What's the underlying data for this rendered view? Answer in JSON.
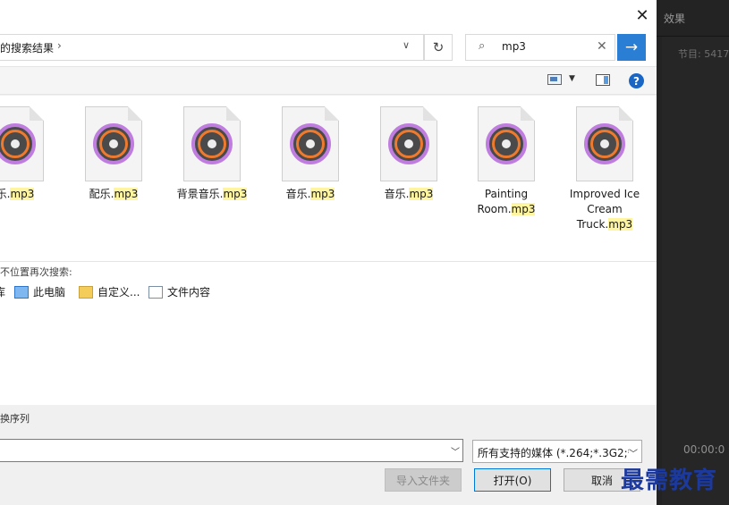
{
  "background_app": {
    "effects_tab": "效果",
    "program_label": "节目: 5417",
    "timecode": "00:00:0"
  },
  "dialog": {
    "address": {
      "breadcrumb": "的搜索结果",
      "breadcrumb_sep": "›",
      "dropdown": "∨",
      "refresh": "↻"
    },
    "search": {
      "icon": "⌕",
      "value": "mp3",
      "clear": "✕",
      "go": "→"
    },
    "close": "✕",
    "help": "?",
    "files": [
      {
        "name_prefix": "乐.",
        "ext": "mp3",
        "lines": []
      },
      {
        "name_prefix": "配乐.",
        "ext": "mp3",
        "lines": []
      },
      {
        "name_prefix": "背景音乐.",
        "ext": "mp3",
        "lines": []
      },
      {
        "name_prefix": "音乐.",
        "ext": "mp3",
        "lines": []
      },
      {
        "name_prefix": "音乐.",
        "ext": "mp3",
        "lines": []
      },
      {
        "name_prefix": "Room.",
        "ext": "mp3",
        "pre_line": "Painting"
      },
      {
        "name_prefix": "Truck.",
        "ext": "mp3",
        "pre_line": "Improved Ice Cream"
      }
    ],
    "search_again": {
      "label": "不位置再次搜索:",
      "locations": [
        "库",
        "此电脑",
        "自定义...",
        "文件内容"
      ]
    },
    "bottom": {
      "seq_label": "换序列",
      "file_type": "所有支持的媒体 (*.264;*.3G2;*",
      "import_folder": "导入文件夹",
      "open": "打开(O)",
      "cancel": "取消"
    }
  },
  "watermark": "最需教育"
}
